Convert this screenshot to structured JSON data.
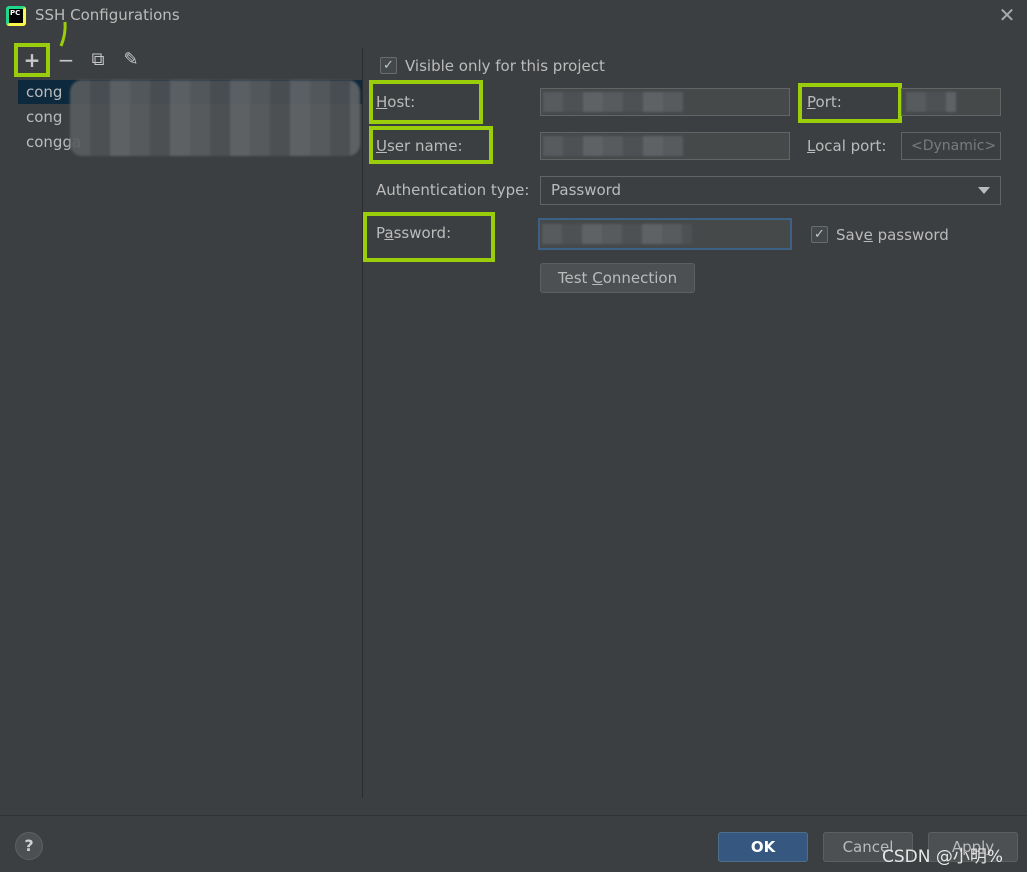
{
  "window": {
    "title": "SSH Configurations",
    "close_glyph": "✕",
    "app_icon": "pycharm-icon",
    "app_icon_text": "PC"
  },
  "toolbar": {
    "add_glyph": "+",
    "remove_glyph": "−",
    "copy_glyph": "⧉",
    "edit_glyph": "✎"
  },
  "configs": [
    {
      "label": "cong",
      "selected": true
    },
    {
      "label": "cong",
      "selected": false
    },
    {
      "label": "congga",
      "selected": false
    }
  ],
  "form": {
    "visible_only_label": "Visible only for this project",
    "visible_only_checked": true,
    "host_label_pre": "",
    "host_label_mn": "H",
    "host_label_post": "ost:",
    "port_label_pre": "",
    "port_label_mn": "P",
    "port_label_post": "ort:",
    "username_label_pre": "",
    "username_label_mn": "U",
    "username_label_post": "ser name:",
    "local_port_label_pre": "",
    "local_port_label_mn": "L",
    "local_port_label_post": "ocal port:",
    "local_port_placeholder": "<Dynamic>",
    "auth_type_label": "Authentication type:",
    "auth_type_value": "Password",
    "password_label_pre": "P",
    "password_label_mn": "a",
    "password_label_post": "ssword:",
    "save_password_pre": "Sav",
    "save_password_mn": "e",
    "save_password_post": " password",
    "save_password_checked": true,
    "test_connection_pre": "Test ",
    "test_connection_mn": "C",
    "test_connection_post": "onnection"
  },
  "footer": {
    "help_glyph": "?",
    "ok_label": "OK",
    "cancel_label": "Cancel",
    "apply_label": "Apply",
    "watermark": "CSDN @小明%"
  },
  "colors": {
    "highlight": "#9acd0a",
    "accent": "#365880",
    "selection": "#0d293e"
  }
}
